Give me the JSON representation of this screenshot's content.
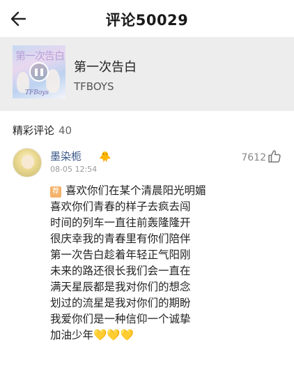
{
  "header": {
    "title": "评论50029",
    "back_icon": "arrow-left-icon"
  },
  "song": {
    "title": "第一次告白",
    "artist": "TFBOYS",
    "cover_title": "第一次告白",
    "cover_brand": "TFBoys",
    "play_state_icon": "pause-icon"
  },
  "section": {
    "label": "精彩评论",
    "count": "40"
  },
  "comment": {
    "username": "墨染栀",
    "badge": "🐥",
    "time": "08-05 12:54",
    "likes": "7612",
    "tag": "荐",
    "lines": [
      "喜欢你们在某个清晨阳光明媚",
      "喜欢你们青春的样子去疯去闯",
      "时间的列车一直往前轰隆隆开",
      "很庆幸我的青春里有你们陪伴",
      "第一次告白趁着年轻正气阳刚",
      "未来的路还很长我们会一直在",
      "满天星辰都是我对你们的想念",
      "划过的流星是我对你们的期盼",
      "我爱你们是一种信仰一个诚挚",
      "加油少年💛💛💛"
    ]
  },
  "colors": {
    "card_bg": "#ededed",
    "username": "#3b5a88",
    "tag_bg": "#f4b26a",
    "muted": "#999999"
  }
}
